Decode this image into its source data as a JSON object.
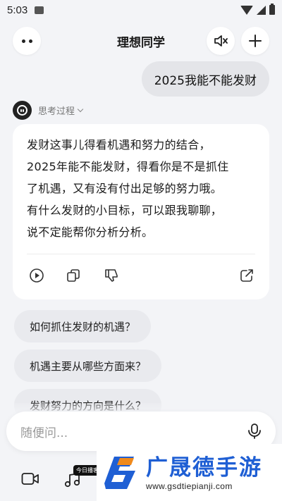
{
  "status_bar": {
    "time": "5:03"
  },
  "header": {
    "title": "理想同学"
  },
  "user_message": "2025我能不能发财",
  "ai": {
    "thinking_label": "思考过程",
    "answer_lines": [
      "发财这事儿得看机遇和努力的结合，",
      "2025年能不能发财，得看你是不是抓住",
      "了机遇，又有没有付出足够的努力哦。",
      "有什么发财的小目标，可以跟我聊聊，",
      "说不定能帮你分析分析。"
    ]
  },
  "suggestions": [
    "如何抓住发财的机遇？",
    "机遇主要从哪些方面来？",
    "发财努力的方向是什么？"
  ],
  "input": {
    "placeholder": "随便问..."
  },
  "bottom_bar": {
    "today_tag": "今日播客"
  },
  "watermark": {
    "title": "广晟德手游",
    "url": "www.gsdtiepianji.com"
  },
  "colors": {
    "accent_blue": "#1f5fd4",
    "watermark_orange": "#f08a1c"
  },
  "icons": [
    "more-icon",
    "mute-icon",
    "plus-icon",
    "play-icon",
    "copy-icon",
    "dislike-icon",
    "share-icon",
    "mic-icon",
    "video-icon",
    "music-icon"
  ]
}
